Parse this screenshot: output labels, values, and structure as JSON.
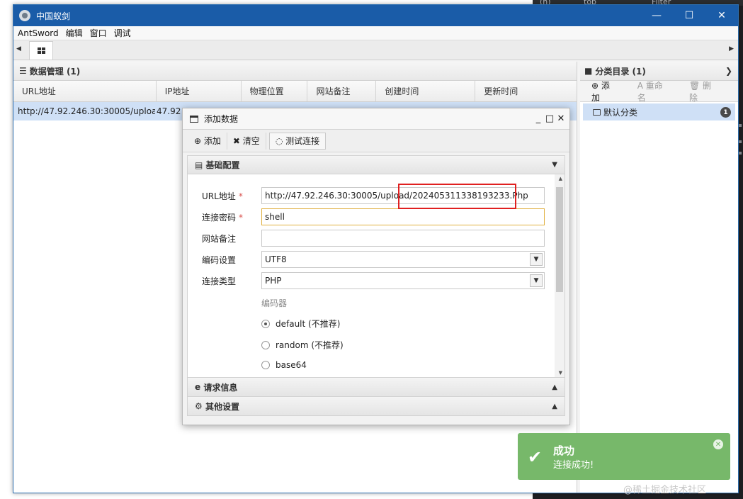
{
  "background_app": {
    "top_labels": [
      "(h)",
      "top",
      "Filter"
    ]
  },
  "window": {
    "title": "中国蚁剑",
    "controls": {
      "minimize": "—",
      "maximize": "☐",
      "close": "✕"
    }
  },
  "menu": [
    "AntSword",
    "编辑",
    "窗口",
    "调试"
  ],
  "data_panel": {
    "title": "数据管理 (1)",
    "columns": [
      "URL地址",
      "IP地址",
      "物理位置",
      "网站备注",
      "创建时间",
      "更新时间"
    ],
    "rows": [
      {
        "url": "http://47.92.246.30:30005/uploac",
        "ip": "47.92"
      }
    ]
  },
  "category_panel": {
    "title": "分类目录 (1)",
    "toolbar": {
      "add": "添加",
      "rename": "重命名",
      "delete": "删除"
    },
    "items": [
      {
        "label": "默认分类",
        "count": "1"
      }
    ]
  },
  "dialog": {
    "title": "添加数据",
    "toolbar": {
      "add": "添加",
      "clear": "清空",
      "test": "测试连接"
    },
    "sections": {
      "basic": "基础配置",
      "request": "请求信息",
      "other": "其他设置"
    },
    "fields": {
      "url_label": "URL地址",
      "url_value": "http://47.92.246.30:30005/upload/202405311338193233.Php",
      "password_label": "连接密码",
      "password_value": "shell",
      "note_label": "网站备注",
      "note_value": "",
      "encoding_label": "编码设置",
      "encoding_value": "UTF8",
      "type_label": "连接类型",
      "type_value": "PHP",
      "required_mark": "*"
    },
    "encoder": {
      "label": "编码器",
      "options": [
        {
          "label": "default (不推荐)",
          "checked": true
        },
        {
          "label": "random (不推荐)",
          "checked": false
        },
        {
          "label": "base64",
          "checked": false
        }
      ]
    }
  },
  "toast": {
    "title": "成功",
    "message": "连接成功!",
    "color": "#77b86a"
  },
  "watermark": "@稀土掘金技术社区"
}
